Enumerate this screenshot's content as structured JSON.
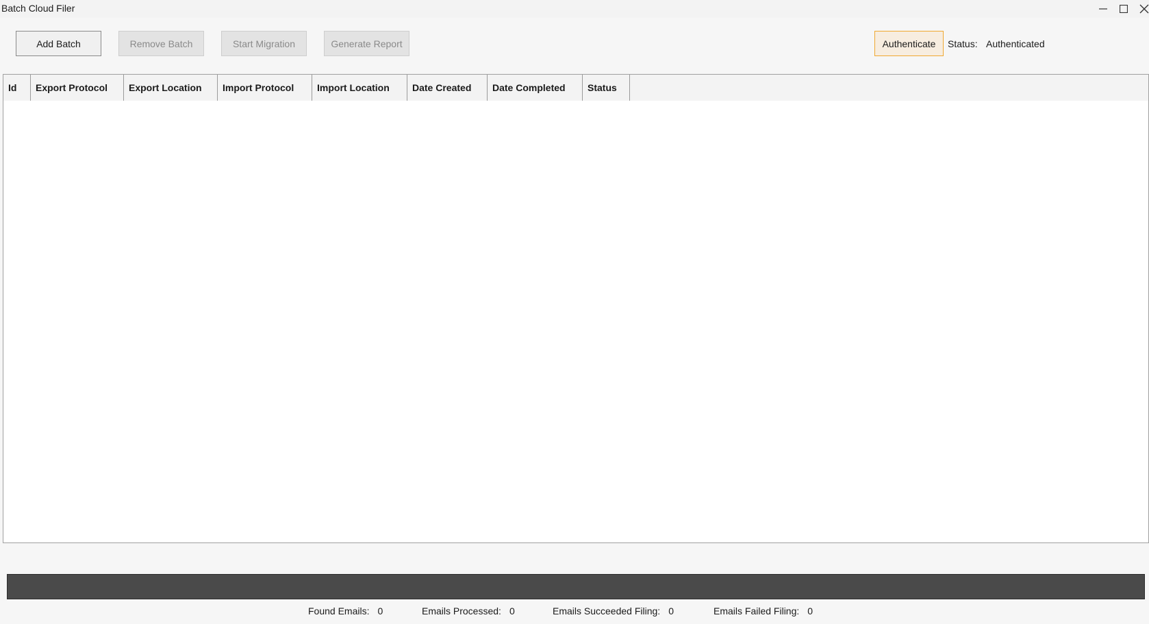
{
  "window": {
    "title": "Batch Cloud Filer"
  },
  "toolbar": {
    "add_batch": "Add Batch",
    "remove_batch": "Remove Batch",
    "start_migration": "Start Migration",
    "generate_report": "Generate Report",
    "authenticate": "Authenticate",
    "status_label": "Status:",
    "status_value": "Authenticated"
  },
  "grid": {
    "columns": [
      "Id",
      "Export Protocol",
      "Export Location",
      "Import Protocol",
      "Import Location",
      "Date Created",
      "Date Completed",
      "Status"
    ],
    "rows": []
  },
  "progress": {
    "fraction": 0
  },
  "stats": {
    "found_emails_label": "Found Emails:",
    "found_emails_value": "0",
    "emails_processed_label": "Emails Processed:",
    "emails_processed_value": "0",
    "emails_succeeded_label": "Emails Succeeded Filing:",
    "emails_succeeded_value": "0",
    "emails_failed_label": "Emails Failed Filing:",
    "emails_failed_value": "0"
  },
  "colors": {
    "authenticate_border": "#f0a830",
    "progress_track": "#4a4a4a"
  },
  "icons": {
    "minimize": "minimize-icon",
    "maximize": "maximize-icon",
    "close": "close-icon"
  }
}
